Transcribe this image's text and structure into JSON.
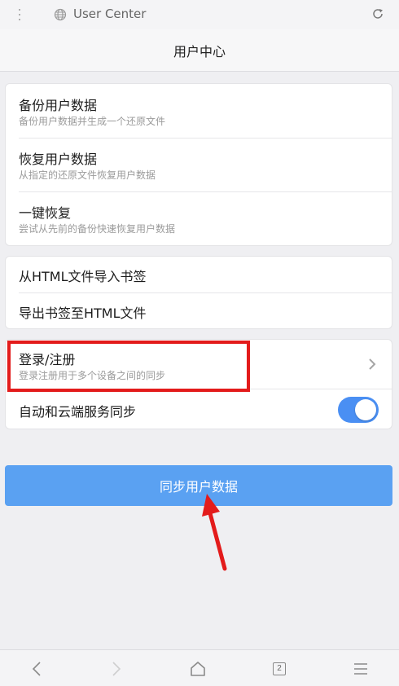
{
  "address_bar": {
    "text": "User Center",
    "menu_icon": "more-vertical-icon",
    "site_icon": "globe-icon",
    "refresh_icon": "refresh-icon"
  },
  "header": {
    "title": "用户中心"
  },
  "data_section": {
    "items": [
      {
        "label": "备份用户数据",
        "sub": "备份用户数据并生成一个还原文件"
      },
      {
        "label": "恢复用户数据",
        "sub": "从指定的还原文件恢复用户数据"
      },
      {
        "label": "一键恢复",
        "sub": "尝试从先前的备份快速恢复用户数据"
      }
    ]
  },
  "bookmark_section": {
    "items": [
      {
        "label": "从HTML文件导入书签"
      },
      {
        "label": "导出书签至HTML文件"
      }
    ]
  },
  "account_section": {
    "login": {
      "label": "登录/注册",
      "sub": "登录注册用于多个设备之间的同步",
      "icon": "chevron-right-icon"
    },
    "auto_sync": {
      "label": "自动和云端服务同步",
      "enabled": true
    }
  },
  "sync_button": {
    "label": "同步用户数据"
  },
  "bottom_nav": {
    "back_icon": "back-icon",
    "forward_icon": "forward-icon",
    "home_icon": "home-icon",
    "tabs_count": "2",
    "menu_icon": "menu-icon"
  },
  "colors": {
    "accent": "#4a8ff3",
    "button": "#5aa1f2",
    "annotation": "#e31b1b"
  }
}
